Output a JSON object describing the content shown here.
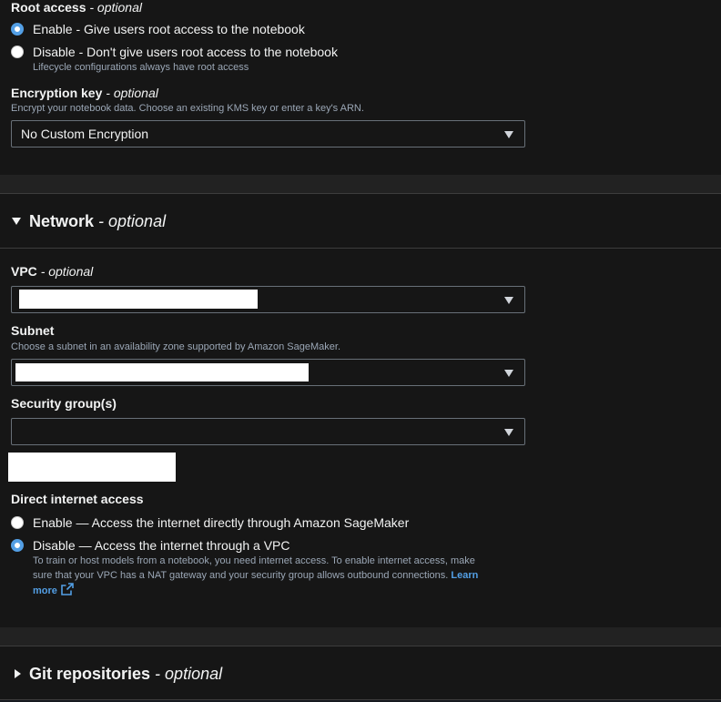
{
  "root_access": {
    "label": "Root access",
    "optional": "- optional",
    "enable_label": "Enable - Give users root access to the notebook",
    "disable_label": "Disable - Don't give users root access to the notebook",
    "disable_desc": "Lifecycle configurations always have root access",
    "selected": "enable"
  },
  "encryption": {
    "label": "Encryption key",
    "optional": "- optional",
    "desc": "Encrypt your notebook data. Choose an existing KMS key or enter a key's ARN.",
    "value": "No Custom Encryption"
  },
  "network": {
    "title": "Network",
    "optional": "- optional",
    "vpc": {
      "label": "VPC",
      "optional": "- optional"
    },
    "subnet": {
      "label": "Subnet",
      "desc": "Choose a subnet in an availability zone supported by Amazon SageMaker."
    },
    "security_groups": {
      "label": "Security group(s)"
    },
    "direct_internet": {
      "label": "Direct internet access",
      "enable_label": "Enable — Access the internet directly through Amazon SageMaker",
      "disable_label": "Disable — Access the internet through a VPC",
      "disable_desc_line1": "To train or host models from a notebook, you need internet access. To enable internet access, make",
      "disable_desc_line2": "sure that your VPC has a NAT gateway and your security group allows outbound connections.",
      "learn_more_1": "Learn",
      "learn_more_2": "more",
      "selected": "disable"
    }
  },
  "git": {
    "title": "Git repositories",
    "optional": "- optional"
  },
  "colors": {
    "accent": "#539fe5",
    "background": "#161616",
    "text": "#f2f3f3",
    "muted": "#9ba7b6"
  }
}
